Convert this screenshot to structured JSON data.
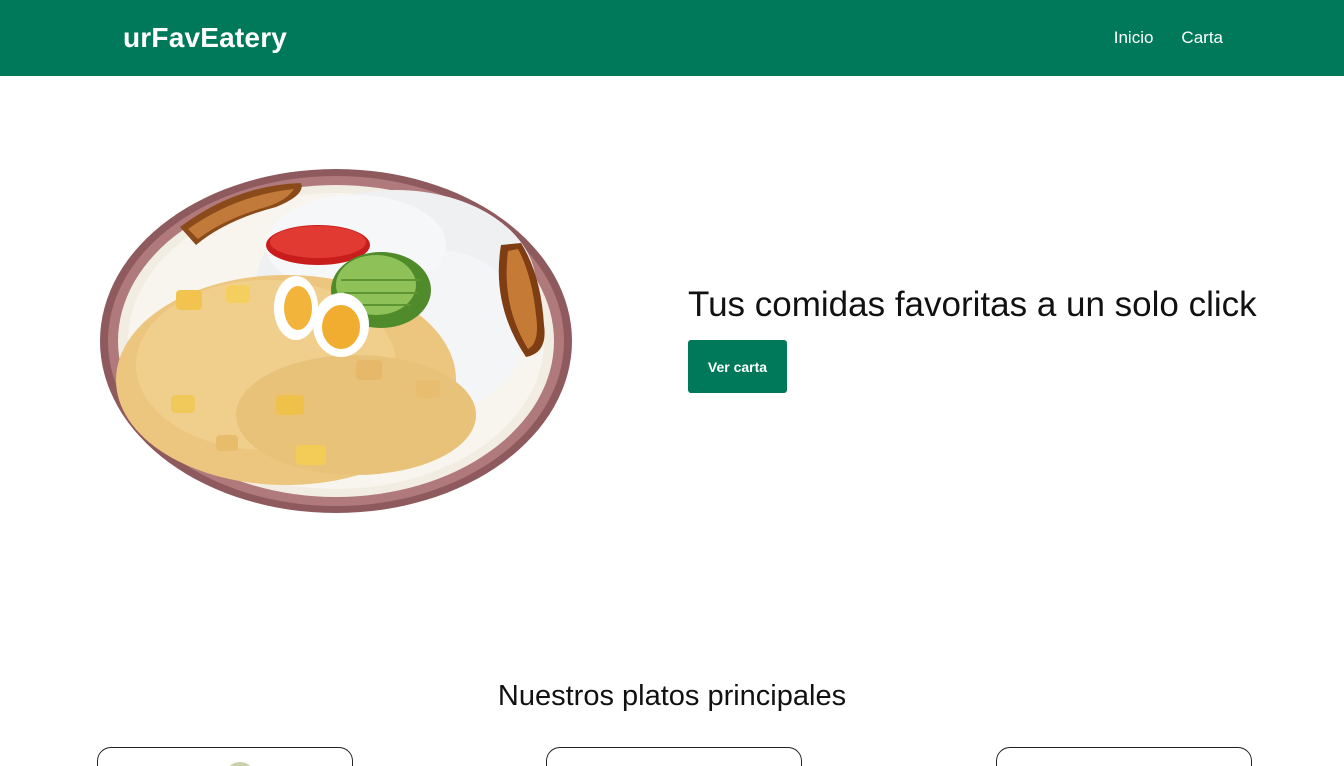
{
  "navbar": {
    "brand": "urFavEatery",
    "links": [
      {
        "label": "Inicio"
      },
      {
        "label": "Carta"
      }
    ],
    "background": "#00795a"
  },
  "hero": {
    "title": "Tus comidas favoritas a un solo click",
    "button_label": "Ver carta",
    "image": "dish-photo"
  },
  "featured": {
    "title": "Nuestros platos principales"
  },
  "colors": {
    "accent": "#00795a",
    "text": "#111111",
    "background": "#ffffff"
  }
}
